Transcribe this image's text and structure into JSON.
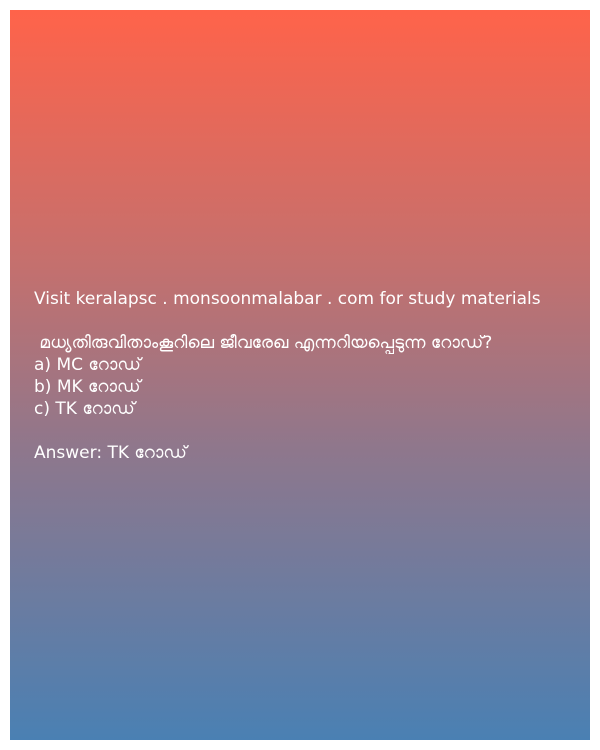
{
  "post": {
    "site_line": "Visit keralapsc . monsoonmalabar . com for study materials",
    "question": " മധ്യതിരുവിതാംകൂറിലെ ജീവരേഖ എന്നറിയപ്പെടുന്ന റോഡ്?",
    "options": [
      "a) MC റോഡ്",
      "b) MK റോഡ്",
      "c) TK റോഡ്"
    ],
    "answer": "Answer: TK റോഡ്"
  },
  "colors": {
    "gradient_top": "#ff634a",
    "gradient_bottom": "#4a80b3",
    "text": "#ffffff"
  }
}
